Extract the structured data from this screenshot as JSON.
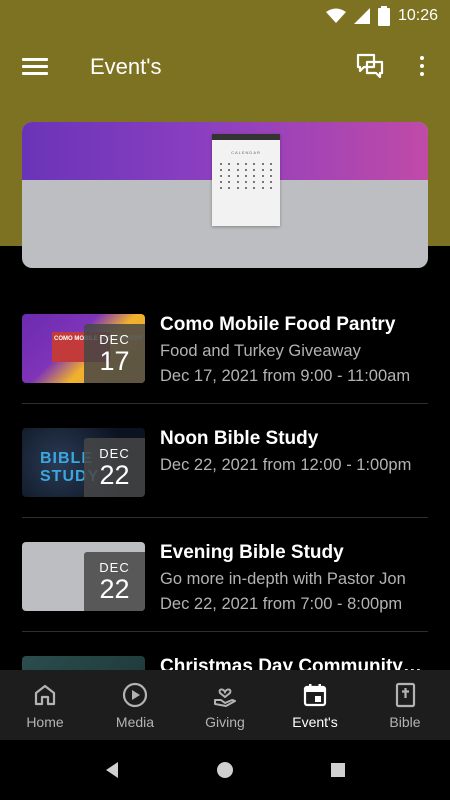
{
  "status_bar": {
    "time": "10:26"
  },
  "header": {
    "title": "Event's"
  },
  "events": [
    {
      "month": "DEC",
      "day": "17",
      "title": "Como Mobile Food Pantry",
      "subtitle": "Food and Turkey Giveaway",
      "when": "Dec 17, 2021 from 9:00 - 11:00am",
      "thumb_text": "COMO MOBILE FOOD PANTRY"
    },
    {
      "month": "DEC",
      "day": "22",
      "title": "Noon Bible Study",
      "subtitle": "",
      "when": "Dec 22, 2021 from 12:00 - 1:00pm",
      "thumb_text": "BIBLE STUDY"
    },
    {
      "month": "DEC",
      "day": "22",
      "title": "Evening Bible Study",
      "subtitle": "Go more in-depth with Pastor Jon",
      "when": "Dec 22, 2021 from 7:00 - 8:00pm",
      "thumb_text": ""
    },
    {
      "month": "",
      "day": "",
      "title": "Christmas Day Community ...",
      "subtitle": "",
      "when": "",
      "thumb_text": ""
    }
  ],
  "bottom_nav": [
    {
      "label": "Home",
      "icon": "home-icon"
    },
    {
      "label": "Media",
      "icon": "play-circle-icon"
    },
    {
      "label": "Giving",
      "icon": "giving-hand-heart-icon"
    },
    {
      "label": "Event's",
      "icon": "calendar-icon",
      "active": true
    },
    {
      "label": "Bible",
      "icon": "bible-icon"
    }
  ],
  "banner": {
    "calendar_label": "CALENDAR"
  },
  "colors": {
    "header_bg": "#7d7222",
    "background": "#000000",
    "nav_bg": "#1d1d1d",
    "banner_purple": "#8b3fc0"
  }
}
